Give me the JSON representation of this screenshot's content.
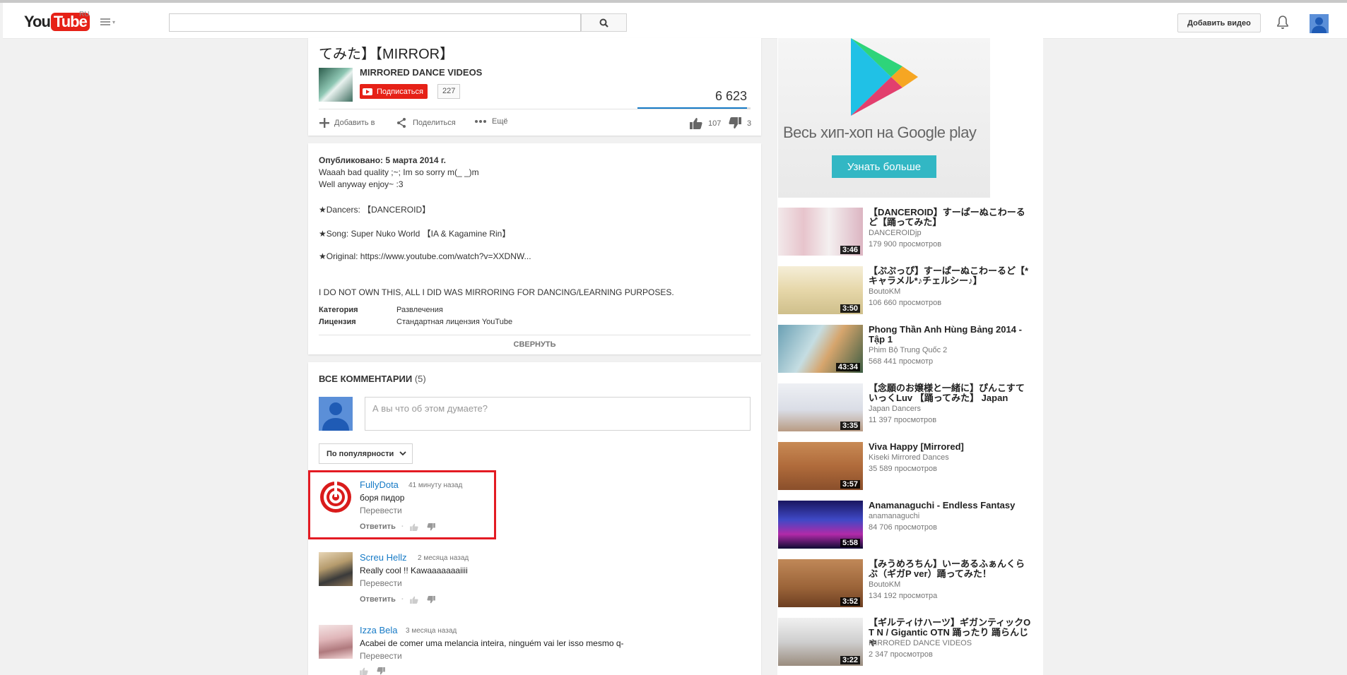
{
  "header": {
    "logo_you": "You",
    "logo_tube": "Tube",
    "region": "RU",
    "search_placeholder": "",
    "upload_label": "Добавить видео"
  },
  "video": {
    "title_partial": "てみた】【MIRROR】",
    "channel_name": "MIRRORED DANCE VIDEOS",
    "subscribe_label": "Подписаться",
    "subscriber_count": "227",
    "view_count": "6 623",
    "actions": {
      "add": "Добавить в",
      "share": "Поделиться",
      "more": "Ещё"
    },
    "likes": "107",
    "dislikes": "3",
    "like_ratio": 0.97
  },
  "description": {
    "published": "Опубликовано: 5 марта 2014 г.",
    "lines": [
      "Waaah bad quality ;~; Im so sorry m(_ _)m",
      "Well anyway enjoy~ :3",
      "★Dancers: 【DANCEROID】",
      "★Song: Super Nuko World 【IA & Kagamine Rin】",
      "★Original: https://www.youtube.com/watch?v=XXDNW...",
      "I DO NOT OWN THIS, ALL I DID WAS MIRRORING FOR DANCING/LEARNING PURPOSES."
    ],
    "meta": [
      {
        "key": "Категория",
        "value": "Развлечения"
      },
      {
        "key": "Лицензия",
        "value": "Стандартная лицензия YouTube"
      }
    ],
    "collapse_label": "СВЕРНУТЬ"
  },
  "comments": {
    "header": "ВСЕ КОММЕНТАРИИ",
    "count": "(5)",
    "input_placeholder": "А вы что об этом думаете?",
    "sort_label": "По популярности",
    "reply_label": "Ответить",
    "translate_label": "Перевести",
    "items": [
      {
        "author": "FullyDota",
        "time": "41 минуту назад",
        "text": "боря пидор"
      },
      {
        "author": "Screu Hellz",
        "time": "2 месяца назад",
        "text": "Really cool !! Kawaaaaaaaiiii"
      },
      {
        "author": "Izza Bela",
        "time": "3 месяца назад",
        "text": "Acabei de comer uma melancia inteira, ninguém vai ler isso mesmo q-"
      }
    ]
  },
  "ad": {
    "text": "Весь хип-хоп на Google play",
    "button": "Узнать больше"
  },
  "related": [
    {
      "title": "【DANCEROID】すーぱーぬこわーるど【踊ってみた】",
      "channel": "DANCEROIDjp",
      "views": "179 900 просмотров",
      "duration": "3:46"
    },
    {
      "title": "【ぷぷっぴ】すーぱーぬこわーるど【*キャラメル*♪チェルシー♪】",
      "channel": "BoutoKM",
      "views": "106 660 просмотров",
      "duration": "3:50"
    },
    {
      "title": "Phong Thần Anh Hùng Bảng 2014 - Tập 1",
      "channel": "Phim Bộ Trung Quốc 2",
      "views": "568 441 просмотр",
      "duration": "43:34"
    },
    {
      "title": "【念願のお嬢様と一緒に】ぴんこすていっくLuv 【踊ってみた】 Japan",
      "channel": "Japan Dancers",
      "views": "11 397 просмотров",
      "duration": "3:35"
    },
    {
      "title": "Viva Happy [Mirrored]",
      "channel": "Kiseki Mirrored Dances",
      "views": "35 589 просмотров",
      "duration": "3:57"
    },
    {
      "title": "Anamanaguchi - Endless Fantasy",
      "channel": "anamanaguchi",
      "views": "84 706 просмотров",
      "duration": "5:58"
    },
    {
      "title": "【みうめろちん】いーあるふぁんくらぶ（ギガP ver）踊ってみた！",
      "channel": "BoutoKM",
      "views": "134 192 просмотра",
      "duration": "3:52"
    },
    {
      "title": "【ギルティけハーツ】ギガンティックO T N / Gigantic OTN 踊ったり 踊らんじゃ",
      "channel": "MIRRORED DANCE VIDEOS",
      "views": "2 347 просмотров",
      "duration": "3:22"
    }
  ]
}
